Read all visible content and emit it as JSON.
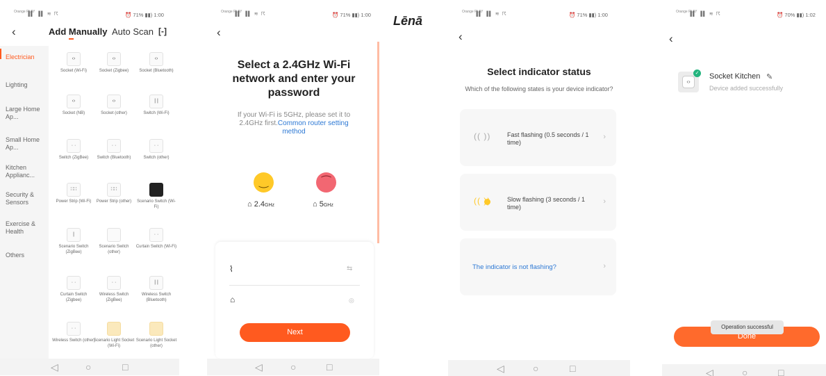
{
  "screen1": {
    "status": {
      "operator": "Orange PLAY",
      "signal": "▐▌ ▐▌ ≋ ☈",
      "right": "⏰ 71% ▮▮) 1:00"
    },
    "back": "‹",
    "tab_manual": "Add Manually",
    "tab_auto": "Auto Scan",
    "scan_icon": "[-]",
    "categories": [
      "Electrician",
      "Lighting",
      "Large Home Ap...",
      "Small Home Ap...",
      "Kitchen Applianc...",
      "Security & Sensors",
      "Exercise & Health",
      "Others"
    ],
    "devices": [
      {
        "label": "Socket (Wi-Fi)",
        "glyph": "‹›"
      },
      {
        "label": "Socket (Zigbee)",
        "glyph": "‹›"
      },
      {
        "label": "Socket (Bluetooth)",
        "glyph": "‹›"
      },
      {
        "label": "Socket (NB)",
        "glyph": "‹›"
      },
      {
        "label": "Socket (other)",
        "glyph": "‹›"
      },
      {
        "label": "Switch (Wi-Fi)",
        "glyph": "| |"
      },
      {
        "label": "Switch (ZigBee)",
        "glyph": "· ·"
      },
      {
        "label": "Switch (Bluetooth)",
        "glyph": "· ·"
      },
      {
        "label": "Switch (other)",
        "glyph": "· ·"
      },
      {
        "label": "Power Strip (Wi-Fi)",
        "glyph": "∷∷"
      },
      {
        "label": "Power Strip (other)",
        "glyph": "∷∷"
      },
      {
        "label": "Scenario Switch (Wi-Fi)",
        "glyph": ""
      },
      {
        "label": "Scenario Switch (ZigBee)",
        "glyph": "|"
      },
      {
        "label": "Scenario Switch (other)",
        "glyph": ""
      },
      {
        "label": "Curtain Switch (Wi-Fi)",
        "glyph": "· ·"
      },
      {
        "label": "Curtain Switch (Zigbee)",
        "glyph": "· ·"
      },
      {
        "label": "Wireless Switch (ZigBee)",
        "glyph": "· ·"
      },
      {
        "label": "Wireless Switch (Bluetooth)",
        "glyph": "| |"
      },
      {
        "label": "Wireless Switch (other)",
        "glyph": "· ·"
      },
      {
        "label": "Scenario Light Socket (Wi-Fi)",
        "glyph": ""
      },
      {
        "label": "Scenario Light Socket (other)",
        "glyph": ""
      }
    ],
    "nav": {
      "back": "◁",
      "home": "○",
      "recent": "□"
    }
  },
  "screen2": {
    "status": {
      "operator": "Orange PLAY",
      "signal": "▐▌ ▐▌ ≋ ☈",
      "right": "⏰ 71% ▮▮) 1:00"
    },
    "back": "‹",
    "title": "Select a 2.4GHz Wi-Fi network and enter your password",
    "desc": "If your Wi-Fi is 5GHz, please set it to 2.4GHz first.",
    "desc_link": "Common router setting method",
    "band_good": "2.4",
    "band_good_unit": "GHz",
    "band_bad": "5",
    "band_bad_unit": "GHz",
    "smile": "‿",
    "sad": "⁀",
    "router_icon": "⌂",
    "wifi_icon": "⌇",
    "swap_icon": "⇆",
    "lock_icon": "⌂",
    "eye_icon": "◎",
    "next_label": "Next",
    "nav": {
      "back": "◁",
      "home": "○",
      "recent": "□"
    }
  },
  "label_lena": "Lēnā",
  "screen3": {
    "status": {
      "operator": "Orange PLAY",
      "signal": "▐▌ ▐▌ ≋ ☈",
      "right": "⏰ 71% ▮▮) 1:00"
    },
    "back": "‹",
    "title": "Select indicator status",
    "subtitle": "Which of the following states is your device indicator?",
    "options": [
      {
        "label": "Fast flashing (0.5 seconds / 1 time)",
        "icon": "(( ))"
      },
      {
        "label": "Slow flashing (3 seconds / 1 time)",
        "icon": "((  ))"
      },
      {
        "label": "The indicator is not flashing?",
        "icon": ""
      }
    ],
    "chevron": "›",
    "nav": {
      "back": "◁",
      "home": "○",
      "recent": "□"
    }
  },
  "screen4": {
    "status": {
      "operator": "Orange PLAY",
      "signal": "▐▌ ▐▌ ≋ ☈",
      "right": "⏰ 70% ▮▮) 1:02"
    },
    "back": "‹",
    "device_name": "Socket Kitchen",
    "device_status": "Device added successfully",
    "edit_icon": "✎",
    "check": "✓",
    "socket_glyph": "‹›",
    "done_label": "Done",
    "toast": "Operation successful",
    "nav": {
      "back": "◁",
      "home": "○",
      "recent": "□"
    }
  }
}
